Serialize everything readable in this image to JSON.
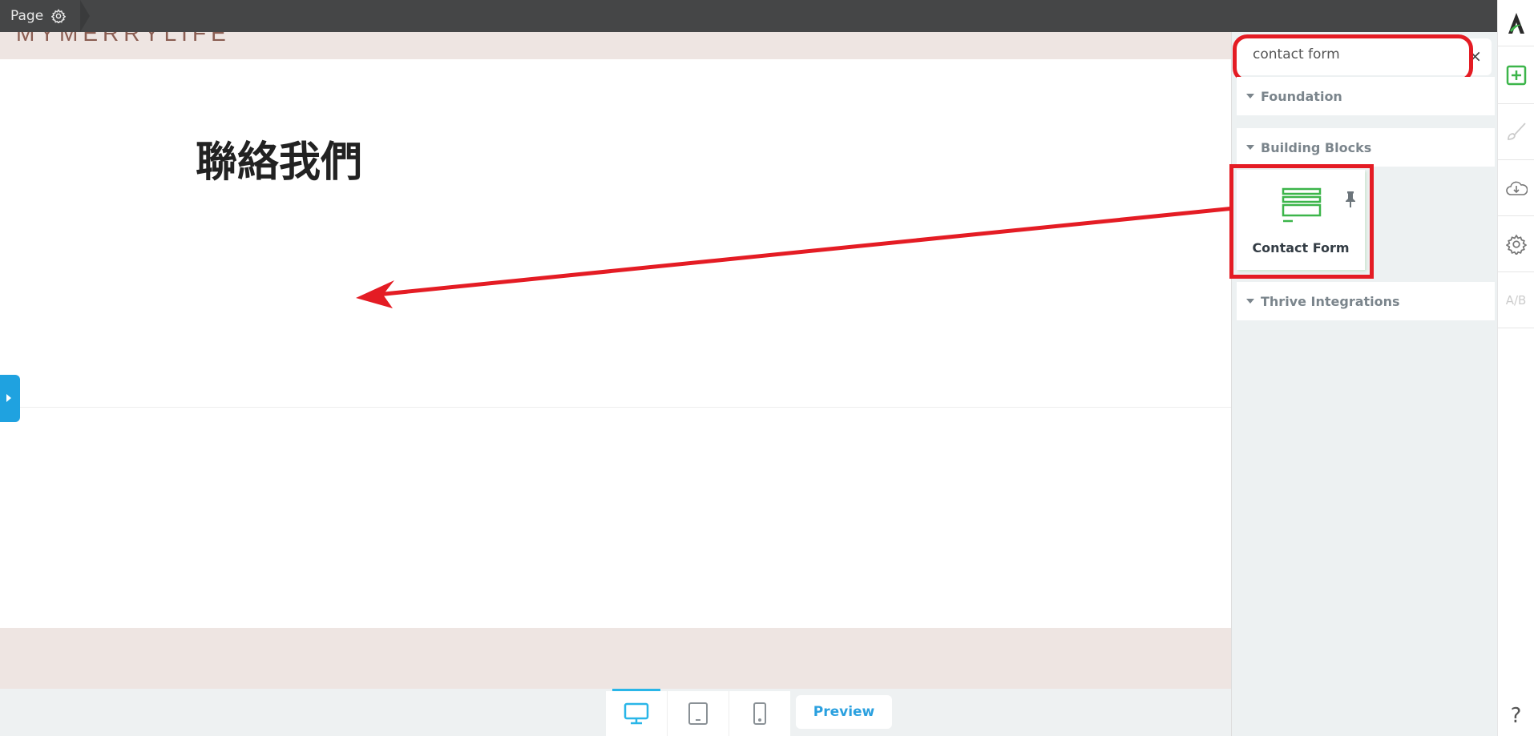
{
  "topbar": {
    "page_label": "Page",
    "icon": "gear-icon"
  },
  "canvas": {
    "site_logo": "MYMERRYLIFE",
    "heading": "聯絡我們"
  },
  "bottombar": {
    "devices": [
      "desktop-icon",
      "tablet-icon",
      "mobile-icon"
    ],
    "active_device": "desktop",
    "preview_label": "Preview"
  },
  "panel": {
    "search_value": "contact form",
    "clear_label": "×",
    "sections": [
      "Foundation",
      "Building Blocks",
      "Thrive Integrations"
    ],
    "result": {
      "label": "Contact Form",
      "icon": "contact-form-icon",
      "pinned_icon": "pin-icon"
    }
  },
  "rail": {
    "items": [
      "logo",
      "add-element-icon",
      "brush-icon",
      "cloud-download-icon",
      "gear-icon",
      "ab-test-icon",
      "help-icon"
    ],
    "ab_label_a": "A",
    "ab_label_b": "B"
  },
  "colors": {
    "accent": "#29b6e8",
    "green": "#3cb54a",
    "annotation": "#e41c24"
  }
}
